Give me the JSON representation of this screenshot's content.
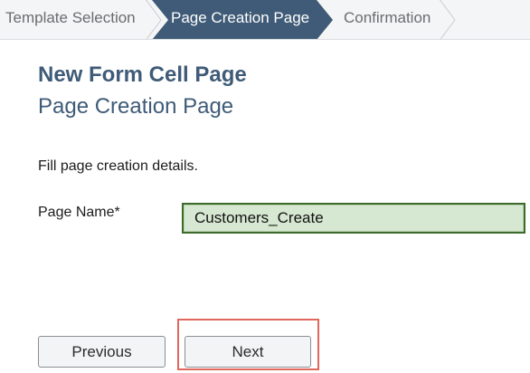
{
  "wizard": {
    "steps": [
      {
        "label": "Template Selection",
        "state": "inactive"
      },
      {
        "label": "Page Creation Page",
        "state": "active"
      },
      {
        "label": "Confirmation",
        "state": "inactive"
      }
    ],
    "active_color": "#3f5b77",
    "inactive_color": "#f4f5f6"
  },
  "page": {
    "title": "New Form Cell Page",
    "subtitle": "Page Creation Page",
    "instructions": "Fill page creation details."
  },
  "form": {
    "page_name_label": "Page Name*",
    "page_name_value": "Customers_Create"
  },
  "buttons": {
    "previous_label": "Previous",
    "next_label": "Next"
  },
  "highlight_color": "#e0675d"
}
